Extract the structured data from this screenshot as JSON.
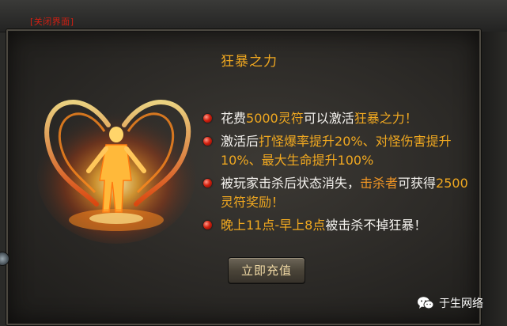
{
  "header": {
    "close_label": "[关闭界面]"
  },
  "panel": {
    "title": "狂暴之力"
  },
  "bullets": [
    {
      "parts": [
        "花费",
        "5000灵符",
        "可以激活",
        "狂暴之力！"
      ]
    },
    {
      "parts": [
        "激活后",
        "打怪爆率提升20%、对怪伤害提升10%、最大生命提升100%"
      ]
    },
    {
      "parts": [
        "被玩家击杀后状态消失，",
        "击杀者",
        "可获得",
        "2500灵符奖励！"
      ]
    },
    {
      "parts": [
        "晚上11点-早上8点",
        "被击杀不掉狂暴！"
      ]
    }
  ],
  "actions": {
    "recharge_label": "立即充值"
  },
  "watermark": {
    "text": "于生网络",
    "icon": "wechat-icon"
  },
  "colors": {
    "accent_gold": "#f0a820",
    "bullet_red": "#d3210f",
    "close_red": "#d21f12"
  }
}
